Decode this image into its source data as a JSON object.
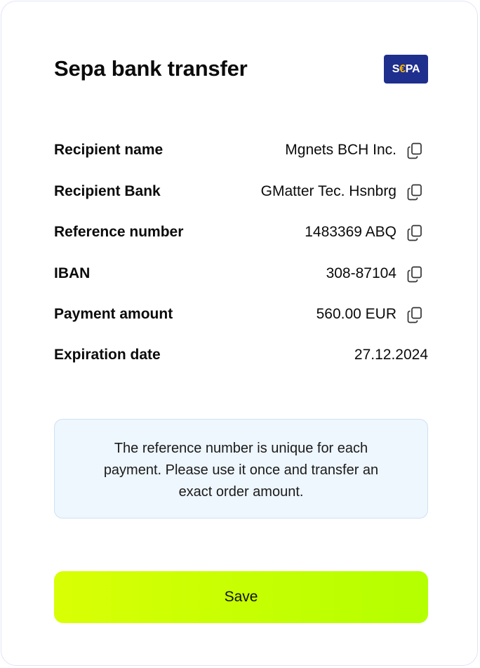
{
  "header": {
    "title": "Sepa bank transfer",
    "logo": {
      "text_left": "S",
      "text_euro": "€",
      "text_right": "PA",
      "bg": "#1e2f8e",
      "accent": "#f7b500"
    }
  },
  "details": [
    {
      "label": "Recipient name",
      "value": "Mgnets BCH Inc.",
      "copy_icon": "copy-icon"
    },
    {
      "label": "Recipient Bank",
      "value": "GMatter Tec. Hsnbrg",
      "copy_icon": "copy-icon"
    },
    {
      "label": "Reference number",
      "value": "1483369 ABQ",
      "copy_icon": "copy-icon"
    },
    {
      "label": "IBAN",
      "value": "308-87104",
      "copy_icon": "copy-icon"
    },
    {
      "label": "Payment amount",
      "value": "560.00 EUR",
      "copy_icon": "copy-icon"
    },
    {
      "label": "Expiration date",
      "value": "27.12.2024"
    }
  ],
  "note": {
    "text": "The reference number is unique for each payment. Please use it once and transfer an exact order amount."
  },
  "actions": {
    "save_label": "Save"
  },
  "colors": {
    "button_gradient_start": "#d9ff04",
    "button_gradient_end": "#b4ff00",
    "note_bg": "#eef6fe",
    "note_border": "#cfe2f3"
  }
}
